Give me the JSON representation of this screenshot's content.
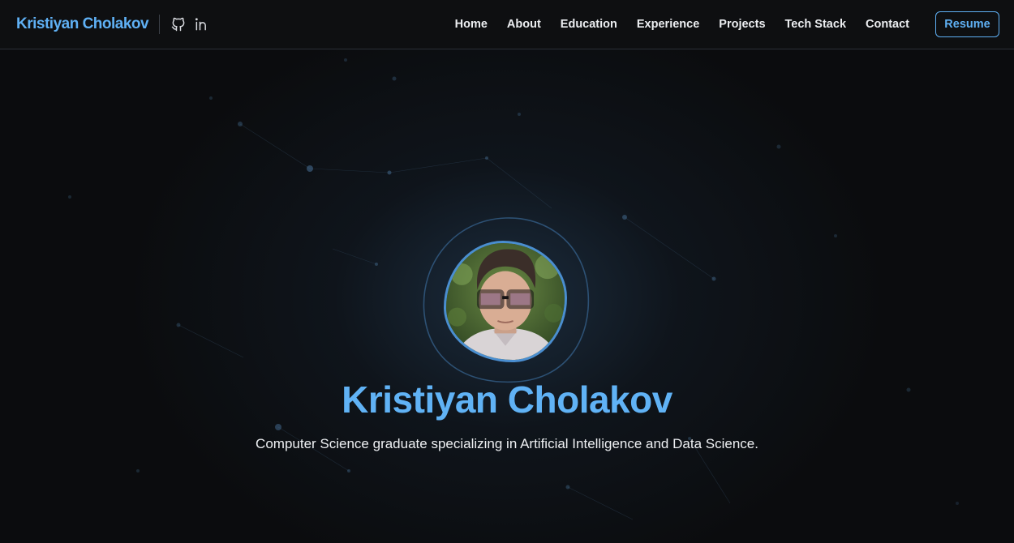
{
  "header": {
    "brand": "Kristiyan Cholakov",
    "social": [
      {
        "icon": "github-icon"
      },
      {
        "icon": "linkedin-icon"
      }
    ],
    "nav": [
      "Home",
      "About",
      "Education",
      "Experience",
      "Projects",
      "Tech Stack",
      "Contact"
    ],
    "resume_label": "Resume"
  },
  "hero": {
    "name": "Kristiyan Cholakov",
    "subtitle": "Computer Science graduate specializing in Artificial Intelligence and Data Science.",
    "avatar_alt": "profile photo"
  },
  "colors": {
    "accent": "#5fb0f4",
    "background": "#0b0c0e",
    "navbar": "#0e0f11",
    "avatar_border": "#4a8ed0"
  }
}
